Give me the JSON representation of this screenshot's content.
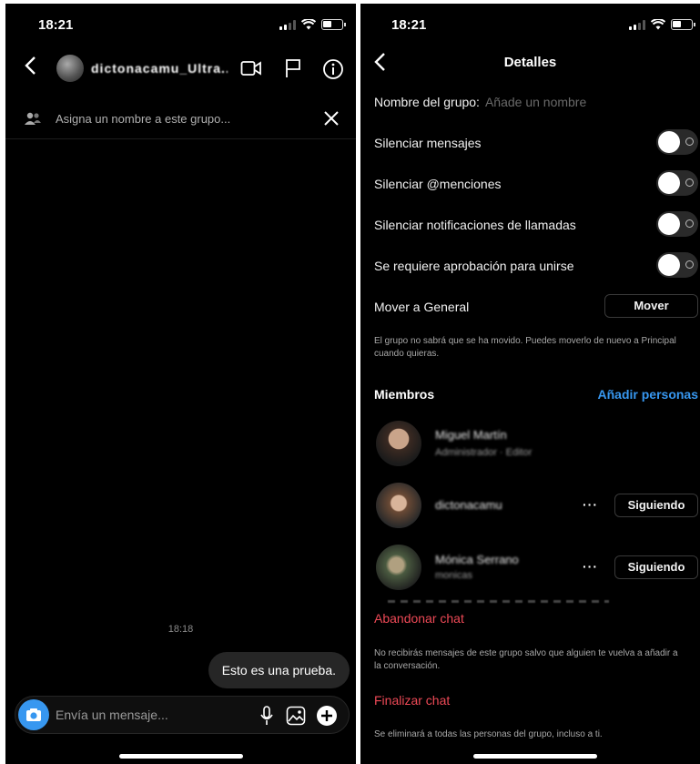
{
  "left": {
    "status_time": "18:21",
    "chat_title": "dictonacamu_Ultra...",
    "name_banner_text": "Asigna un nombre a este grupo...",
    "message_time": "18:18",
    "message_text": "Esto es una prueba.",
    "composer_placeholder": "Envía un mensaje..."
  },
  "right": {
    "status_time": "18:21",
    "title": "Detalles",
    "group_name_label": "Nombre del grupo:",
    "group_name_placeholder": "Añade un nombre",
    "toggles": [
      {
        "label": "Silenciar mensajes",
        "on": false
      },
      {
        "label": "Silenciar @menciones",
        "on": false
      },
      {
        "label": "Silenciar notificaciones de llamadas",
        "on": false
      },
      {
        "label": "Se requiere aprobación para unirse",
        "on": false
      }
    ],
    "move_label": "Mover a General",
    "move_button": "Mover",
    "move_note": "El grupo no sabrá que se ha movido. Puedes moverlo de nuevo a Principal cuando quieras.",
    "members_heading": "Miembros",
    "add_people": "Añadir personas",
    "members": [
      {
        "name": "Miguel Martín",
        "sub": "Administrador · Editor",
        "button": ""
      },
      {
        "name": "dictonacamu",
        "sub": "",
        "button": "Siguiendo"
      },
      {
        "name": "Mónica Serrano",
        "sub": "monicas",
        "button": "Siguiendo"
      }
    ],
    "more_icon": "···",
    "leave_chat": "Abandonar chat",
    "leave_note": "No recibirás mensajes de este grupo salvo que alguien te vuelva a añadir a la conversación.",
    "end_chat": "Finalizar chat",
    "end_note": "Se eliminará a todas las personas del grupo, incluso a ti."
  }
}
